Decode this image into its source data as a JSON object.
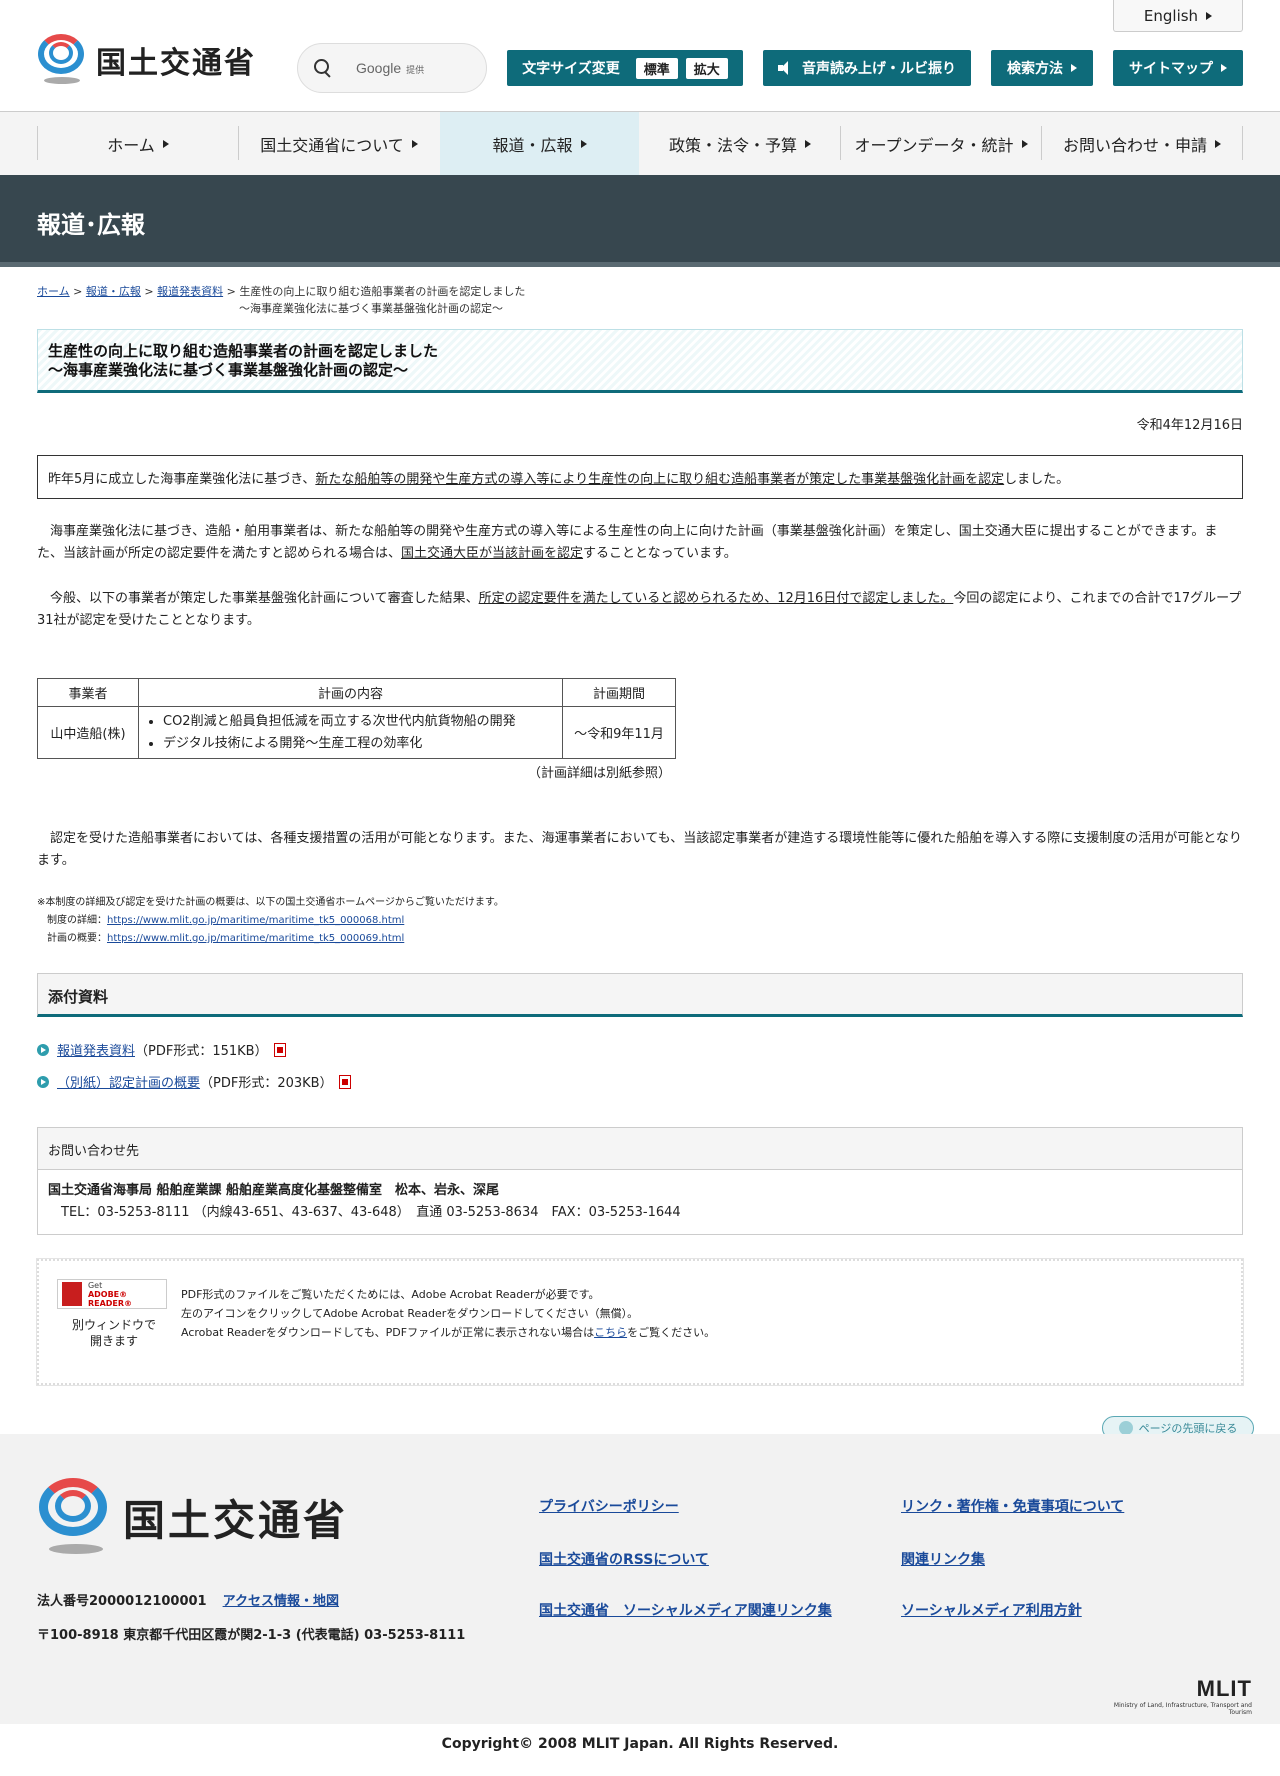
{
  "header": {
    "logo_text": "国土交通省",
    "search_brand": "Google",
    "search_sub": "提供",
    "english": "English",
    "font_size_label": "文字サイズ変更",
    "font_standard": "標準",
    "font_large": "拡大",
    "read_aloud": "音声読み上げ・ルビ振り",
    "search_method": "検索方法",
    "sitemap": "サイトマップ"
  },
  "nav": {
    "items": [
      {
        "label": "ホーム"
      },
      {
        "label": "国土交通省について"
      },
      {
        "label": "報道・広報"
      },
      {
        "label": "政策・法令・予算"
      },
      {
        "label": "オープンデータ・統計"
      },
      {
        "label": "お問い合わせ・申請"
      }
    ]
  },
  "banner": {
    "title": "報道･広報"
  },
  "breadcrumb": {
    "home": "ホーム",
    "press": "報道・広報",
    "releases": "報道発表資料",
    "sep": ">",
    "current_line1": "生産性の向上に取り組む造船事業者の計画を認定しました",
    "current_line2": "～海事産業強化法に基づく事業基盤強化計画の認定～"
  },
  "article": {
    "title_line1": "生産性の向上に取り組む造船事業者の計画を認定しました",
    "title_line2": "～海事産業強化法に基づく事業基盤強化計画の認定～",
    "date": "令和4年12月16日",
    "summary_pre": "昨年5月に成立した海事産業強化法に基づき、",
    "summary_ul": "新たな船舶等の開発や生産方式の導入等により生産性の向上に取り組む造船事業者が策定した事業基盤強化計画を認定",
    "summary_post": "しました。",
    "p1_pre": "　海事産業強化法に基づき、造船・舶用事業者は、新たな船舶等の開発や生産方式の導入等による生産性の向上に向けた計画（事業基盤強化計画）を策定し、国土交通大臣に提出することができます。また、当該計画が所定の認定要件を満たすと認められる場合は、",
    "p1_ul": "国土交通大臣が当該計画を認定",
    "p1_post": "することとなっています。",
    "p2_pre": "　今般、以下の事業者が策定した事業基盤強化計画について審査した結果、",
    "p2_ul": "所定の認定要件を満たしていると認められるため、12月16日付で認定しました。",
    "p2_post": "今回の認定により、これまでの合計で17グループ31社が認定を受けたこととなります。",
    "p3": "　認定を受けた造船事業者においては、各種支援措置の活用が可能となります。また、海運事業者においても、当該認定事業者が建造する環境性能等に優れた船舶を導入する際に支援制度の活用が可能となります。"
  },
  "plan_table": {
    "headers": [
      "事業者",
      "計画の内容",
      "計画期間"
    ],
    "company": "山中造船(株)",
    "contents": [
      "CO2削減と船員負担低減を両立する次世代内航貨物船の開発",
      "デジタル技術による開発～生産工程の効率化"
    ],
    "period": "～令和9年11月",
    "note": "（計画詳細は別紙参照）"
  },
  "small_note": {
    "line1": "※本制度の詳細及び認定を受けた計画の概要は、以下の国土交通省ホームページからご覧いただけます。",
    "detail_label": "制度の詳細：",
    "detail_url": "https://www.mlit.go.jp/maritime/maritime_tk5_000068.html",
    "overview_label": "計画の概要：",
    "overview_url": "https://www.mlit.go.jp/maritime/maritime_tk5_000069.html"
  },
  "attachments": {
    "heading": "添付資料",
    "items": [
      {
        "label": "報道発表資料",
        "meta": "（PDF形式：151KB）"
      },
      {
        "label": "（別紙）認定計画の概要",
        "meta": "（PDF形式：203KB）"
      }
    ]
  },
  "contact": {
    "heading": "お問い合わせ先",
    "dept": "国土交通省海事局 船舶産業課 船舶産業高度化基盤整備室　松本、岩永、深尾",
    "phone": "　TEL：03-5253-8111 （内線43-651、43-637、43-648）　直通 03-5253-8634　FAX：03-5253-1644"
  },
  "acrobat": {
    "badge_get": "Get",
    "badge_name": "ADOBE® READER®",
    "caption_line1": "別ウィンドウで",
    "caption_line2": "開きます",
    "line1": "PDF形式のファイルをご覧いただくためには、Adobe Acrobat Readerが必要です。",
    "line2": "左のアイコンをクリックしてAdobe Acrobat Readerをダウンロードしてください（無償）。",
    "line3_pre": "Acrobat Readerをダウンロードしても、PDFファイルが正常に表示されない場合は",
    "line3_link": "こちら",
    "line3_post": "をご覧ください。"
  },
  "to_top": "ページの先頭に戻る",
  "footer": {
    "logo_text": "国土交通省",
    "corp_number": "法人番号2000012100001",
    "access": "アクセス情報・地図",
    "address": "〒100-8918 東京都千代田区霞が関2-1-3 (代表電話) 03-5253-8111",
    "links": [
      "プライバシーポリシー",
      "リンク・著作権・免責事項について",
      "国土交通省のRSSについて",
      "関連リンク集",
      "国土交通省　ソーシャルメディア関連リンク集",
      "ソーシャルメディア利用方針"
    ],
    "mlit": "MLIT",
    "mlit_sub": "Ministry of Land, Infrastructure, Transport and Tourism",
    "copyright": "Copyright© 2008 MLIT Japan. All Rights Reserved."
  },
  "colors": {
    "accent": "#0e6b7a",
    "banner": "#37474f",
    "link": "#1a4a9a"
  }
}
